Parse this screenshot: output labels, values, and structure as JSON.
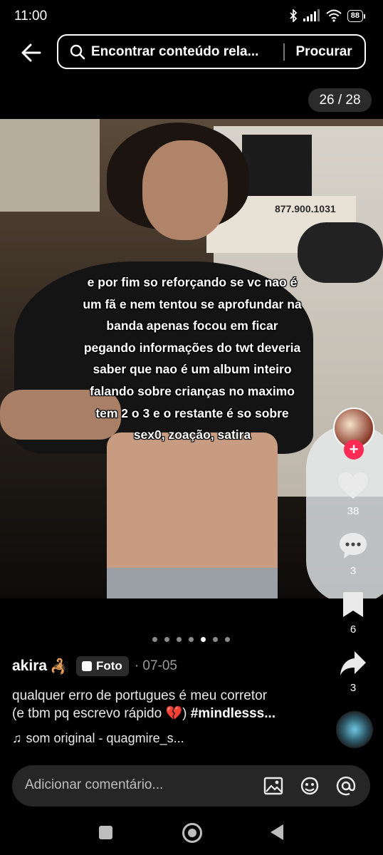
{
  "status_bar": {
    "time": "11:00",
    "battery": "88"
  },
  "search": {
    "query": "Encontrar conteúdo rela...",
    "button": "Procurar"
  },
  "counter": "26 / 28",
  "caption_lines": [
    "e por fim so reforçando se vc nao é",
    "um fã e nem tentou se aprofundar na",
    "banda apenas focou em ficar",
    "pegando informações do twt deveria",
    "saber que nao é um album inteiro",
    "falando sobre crianças no maximo",
    "tem 2 o 3 e o restante é so sobre",
    "sex0, zoação,  satira"
  ],
  "photo_sign_text": "877.900.1031",
  "actions": {
    "likes": "38",
    "comments": "3",
    "bookmarks": "6",
    "shares": "3"
  },
  "carousel": {
    "total_dots": 7,
    "active_index": 4
  },
  "post": {
    "author": "akira",
    "author_emoji": "🦂",
    "type_badge": "Foto",
    "date": "· 07-05",
    "description_line1": "qualquer erro de portugues é meu corretor",
    "description_line2_prefix": "(e tbm pq escrevo rápido",
    "description_emoji": "💔",
    "description_hashtag": "#mindlesss...",
    "music": "som original - quagmire_s..."
  },
  "comment": {
    "placeholder": "Adicionar comentário..."
  },
  "icons": {
    "back": "arrow-left-icon",
    "search": "search-icon",
    "like": "heart-icon",
    "comment": "comment-bubble-icon",
    "bookmark": "bookmark-icon",
    "share": "share-arrow-icon",
    "image": "image-icon",
    "emoji": "emoji-icon",
    "mention": "at-sign-icon"
  },
  "colors": {
    "accent": "#fe2c55",
    "background": "#000000",
    "badge": "#2b2b2b"
  }
}
